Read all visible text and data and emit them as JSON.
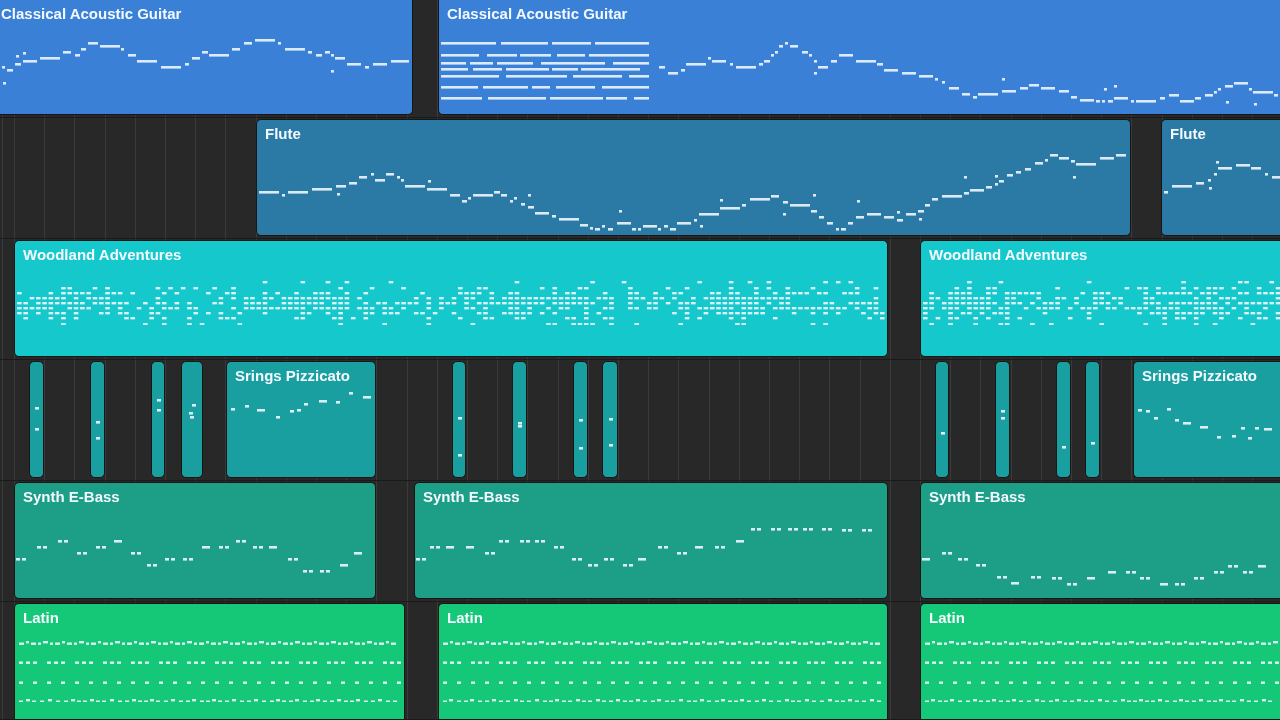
{
  "tracks": [
    {
      "color": "#3a80d6",
      "regions": [
        {
          "kind": "full",
          "name": "Classical Acoustic Guitar"
        },
        {
          "kind": "full",
          "name": "Classical Acoustic Guitar"
        }
      ]
    },
    {
      "color": "#2a7aa5",
      "regions": [
        {
          "kind": "full",
          "name": "Flute"
        },
        {
          "kind": "full",
          "name": "Flute"
        }
      ]
    },
    {
      "color": "#14c8cc",
      "regions": [
        {
          "kind": "full",
          "name": "Woodland Adventures"
        },
        {
          "kind": "full",
          "name": "Woodland Adventures"
        }
      ]
    },
    {
      "color": "#1a9fa0",
      "regions": [
        {
          "kind": "narrow"
        },
        {
          "kind": "narrow"
        },
        {
          "kind": "narrow"
        },
        {
          "kind": "narrow"
        },
        {
          "kind": "full",
          "name": "Srings Pizzicato"
        },
        {
          "kind": "narrow"
        },
        {
          "kind": "narrow"
        },
        {
          "kind": "narrow"
        },
        {
          "kind": "narrow"
        },
        {
          "kind": "narrow"
        },
        {
          "kind": "narrow"
        },
        {
          "kind": "narrow"
        },
        {
          "kind": "narrow"
        },
        {
          "kind": "full",
          "name": "Srings Pizzicato"
        }
      ]
    },
    {
      "color": "#1d9e87",
      "regions": [
        {
          "kind": "full",
          "name": "Synth E-Bass"
        },
        {
          "kind": "full",
          "name": "Synth E-Bass"
        },
        {
          "kind": "full",
          "name": "Synth E-Bass"
        }
      ]
    },
    {
      "color": "#14c878",
      "regions": [
        {
          "kind": "full",
          "name": "Latin"
        },
        {
          "kind": "full",
          "name": "Latin"
        },
        {
          "kind": "full",
          "name": "Latin"
        }
      ]
    }
  ]
}
